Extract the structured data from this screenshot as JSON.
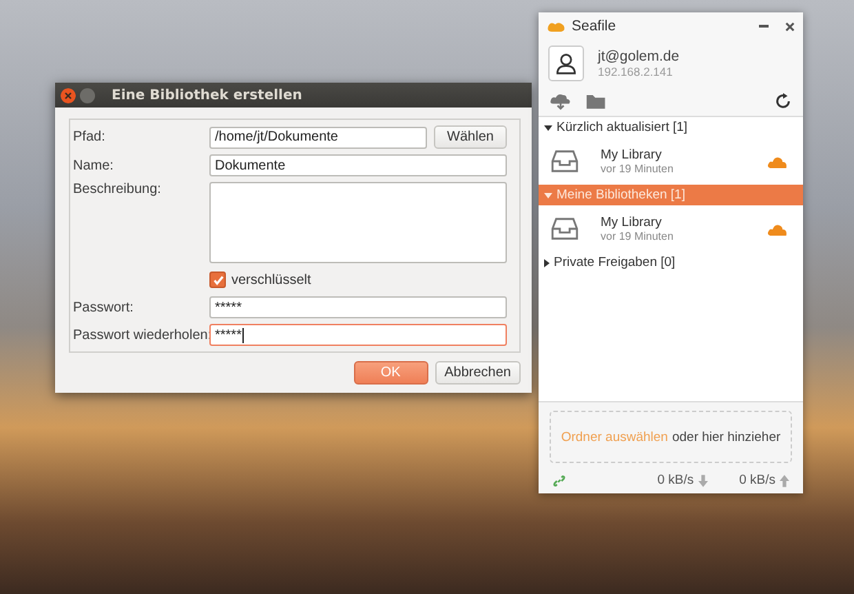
{
  "dialog": {
    "title": "Eine Bibliothek erstellen",
    "fields": [
      {
        "kind": "text",
        "label": "Pfad:",
        "value": "/home/jt/Dokumente",
        "button": "Wählen",
        "focused": false
      },
      {
        "kind": "text",
        "label": "Name:",
        "value": "Dokumente",
        "focused": false
      },
      {
        "kind": "textarea",
        "label": "Beschreibung:",
        "focused": false
      },
      {
        "kind": "checkbox",
        "label": "verschlüsselt",
        "checked": true
      },
      {
        "kind": "password",
        "label": "Passwort:",
        "value": "*****",
        "focused": false
      },
      {
        "kind": "password",
        "label": "Passwort wiederholen:",
        "value": "*****",
        "focused": true
      }
    ],
    "buttons": [
      {
        "label": "OK",
        "default": true
      },
      {
        "label": "Abbrechen",
        "default": false
      }
    ]
  },
  "seafile": {
    "title": "Seafile",
    "account": {
      "email": "jt@golem.de",
      "server": "192.168.2.141"
    },
    "sections": [
      {
        "title": "Kürzlich aktualisiert [1]",
        "expanded": true,
        "selected": false,
        "items": [
          {
            "name": "My Library",
            "time": "vor 19 Minuten"
          }
        ]
      },
      {
        "title": "Meine Bibliotheken [1]",
        "expanded": true,
        "selected": true,
        "items": [
          {
            "name": "My Library",
            "time": "vor 19 Minuten"
          }
        ]
      },
      {
        "title": "Private Freigaben [0]",
        "expanded": false,
        "selected": false
      }
    ],
    "drop": {
      "link": "Ordner auswählen",
      "text": "oder hier hinzieher"
    },
    "status": {
      "download": "0 kB/s",
      "upload": "0 kB/s"
    }
  }
}
